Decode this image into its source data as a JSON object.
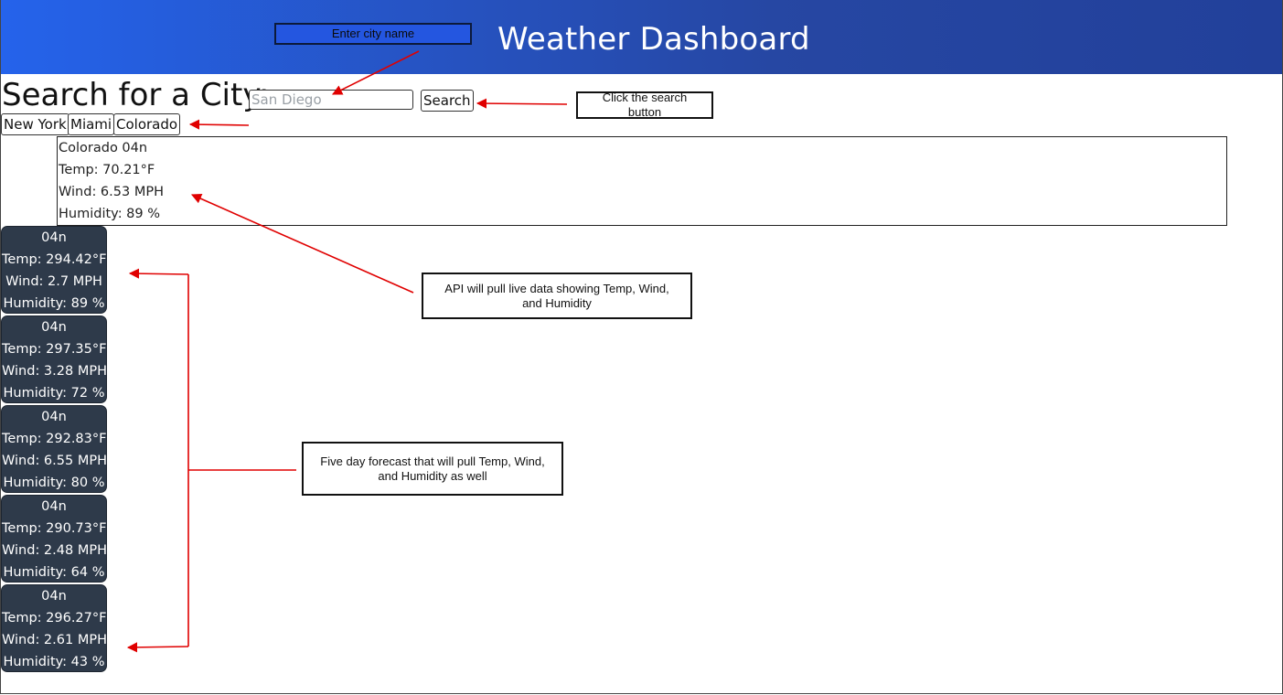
{
  "header": {
    "title": "Weather Dashboard"
  },
  "search": {
    "heading": "Search for a City:",
    "placeholder": "San Diego",
    "button_label": "Search"
  },
  "history": [
    "New York",
    "Miami",
    "Colorado"
  ],
  "current": {
    "city_line": "Colorado 04n",
    "temp": "Temp: 70.21°F",
    "wind": "Wind: 6.53 MPH",
    "humidity": "Humidity: 89 %"
  },
  "forecast": [
    {
      "icon": "04n",
      "temp": "Temp: 294.42°F",
      "wind": "Wind: 2.7 MPH",
      "humidity": "Humidity: 89 %"
    },
    {
      "icon": "04n",
      "temp": "Temp: 297.35°F",
      "wind": "Wind: 3.28 MPH",
      "humidity": "Humidity: 72 %"
    },
    {
      "icon": "04n",
      "temp": "Temp: 292.83°F",
      "wind": "Wind: 6.55 MPH",
      "humidity": "Humidity: 80 %"
    },
    {
      "icon": "04n",
      "temp": "Temp: 290.73°F",
      "wind": "Wind: 2.48 MPH",
      "humidity": "Humidity: 64 %"
    },
    {
      "icon": "04n",
      "temp": "Temp: 296.27°F",
      "wind": "Wind: 2.61 MPH",
      "humidity": "Humidity: 43 %"
    }
  ],
  "annotations": {
    "city": "Enter city name",
    "search": "Click the search button",
    "api": "API will pull live data showing Temp, Wind, and Humidity",
    "forecast": "Five day forecast that will pull Temp, Wind, and Humidity as well"
  },
  "colors": {
    "header_start": "#2563eb",
    "header_end": "#22409a",
    "card_bg": "#2e3a4a",
    "arrow": "#e00000"
  }
}
